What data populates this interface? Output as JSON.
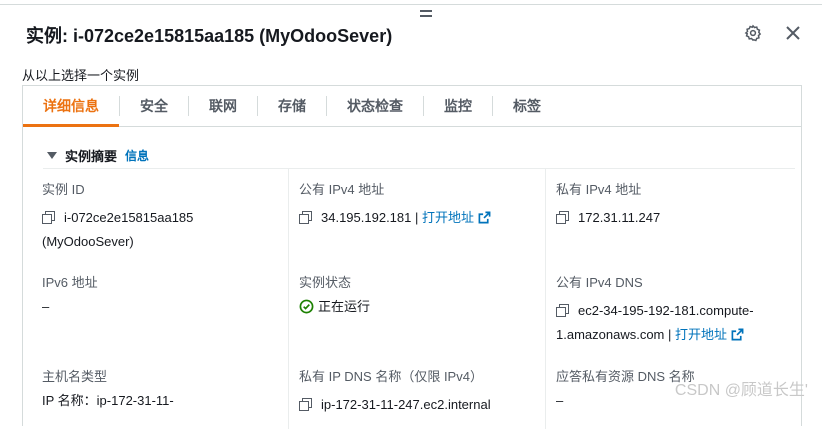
{
  "header": {
    "title": "实例: i-072ce2e15815aa185 (MyOdooSever)",
    "settings_icon": "gear-icon",
    "close_icon": "close-icon"
  },
  "subtitle": "从以上选择一个实例",
  "tabs": [
    {
      "label": "详细信息",
      "active": true
    },
    {
      "label": "安全"
    },
    {
      "label": "联网"
    },
    {
      "label": "存储"
    },
    {
      "label": "状态检查"
    },
    {
      "label": "监控"
    },
    {
      "label": "标签"
    }
  ],
  "summary": {
    "label": "实例摘要",
    "info": "信息"
  },
  "fields": {
    "instance_id": {
      "key": "实例 ID",
      "value_line1": "i-072ce2e15815aa185",
      "value_line2": "(MyOdooSever)"
    },
    "public_ipv4": {
      "key": "公有 IPv4 地址",
      "value": "34.195.192.181",
      "sep": "|",
      "link": "打开地址"
    },
    "private_ipv4": {
      "key": "私有 IPv4 地址",
      "value": "172.31.11.247"
    },
    "ipv6": {
      "key": "IPv6 地址",
      "value": "–"
    },
    "state": {
      "key": "实例状态",
      "value": "正在运行"
    },
    "public_dns": {
      "key": "公有 IPv4 DNS",
      "value_line1": "ec2-34-195-192-181.compute-",
      "value_line2": "1.amazonaws.com",
      "sep": "|",
      "link": "打开地址"
    },
    "hostname_type": {
      "key": "主机名类型",
      "value": "IP 名称：ip-172-31-11-"
    },
    "private_dns": {
      "key": "私有 IP DNS 名称（仅限 IPv4）",
      "value": "ip-172-31-11-247.ec2.internal"
    },
    "answer_dns": {
      "key": "应答私有资源 DNS 名称",
      "value": "–"
    }
  },
  "watermark": "CSDN @顾道长生'",
  "colors": {
    "accent": "#ec7211",
    "link": "#0073bb",
    "success": "#1d8102"
  }
}
